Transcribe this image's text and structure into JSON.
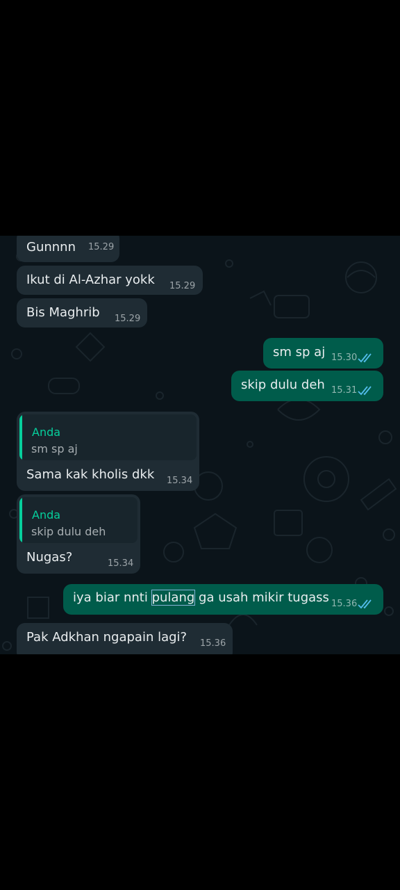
{
  "colors": {
    "background": "#000000",
    "chat_background": "#0b141a",
    "incoming_bubble": "#1f2c34",
    "outgoing_bubble": "#005c4b",
    "quote_accent": "#06cf9c",
    "read_ticks": "#53bdeb"
  },
  "messages": [
    {
      "direction": "in",
      "text": "Gunnnn",
      "time": "15.29"
    },
    {
      "direction": "in",
      "text": "Ikut di Al-Azhar yokk",
      "time": "15.29"
    },
    {
      "direction": "in",
      "text": "Bis Maghrib",
      "time": "15.29"
    },
    {
      "direction": "out",
      "text": "sm sp aj",
      "time": "15.30",
      "status_icon": "double-check-read-icon"
    },
    {
      "direction": "out",
      "text": "skip dulu deh",
      "time": "15.31",
      "status_icon": "double-check-read-icon"
    },
    {
      "direction": "in",
      "quote_author": "Anda",
      "quote_text": "sm sp aj",
      "text": "Sama kak kholis dkk",
      "time": "15.34"
    },
    {
      "direction": "in",
      "quote_author": "Anda",
      "quote_text": "skip dulu deh",
      "text": "Nugas?",
      "time": "15.34"
    },
    {
      "direction": "out",
      "text_before": "iya biar nnti ",
      "text_highlight": "pulang",
      "text_after": " ga usah mikir tugass",
      "time": "15.36",
      "status_icon": "double-check-read-icon"
    },
    {
      "direction": "in",
      "text": "Pak Adkhan ngapain lagi?",
      "time": "15.36"
    }
  ]
}
